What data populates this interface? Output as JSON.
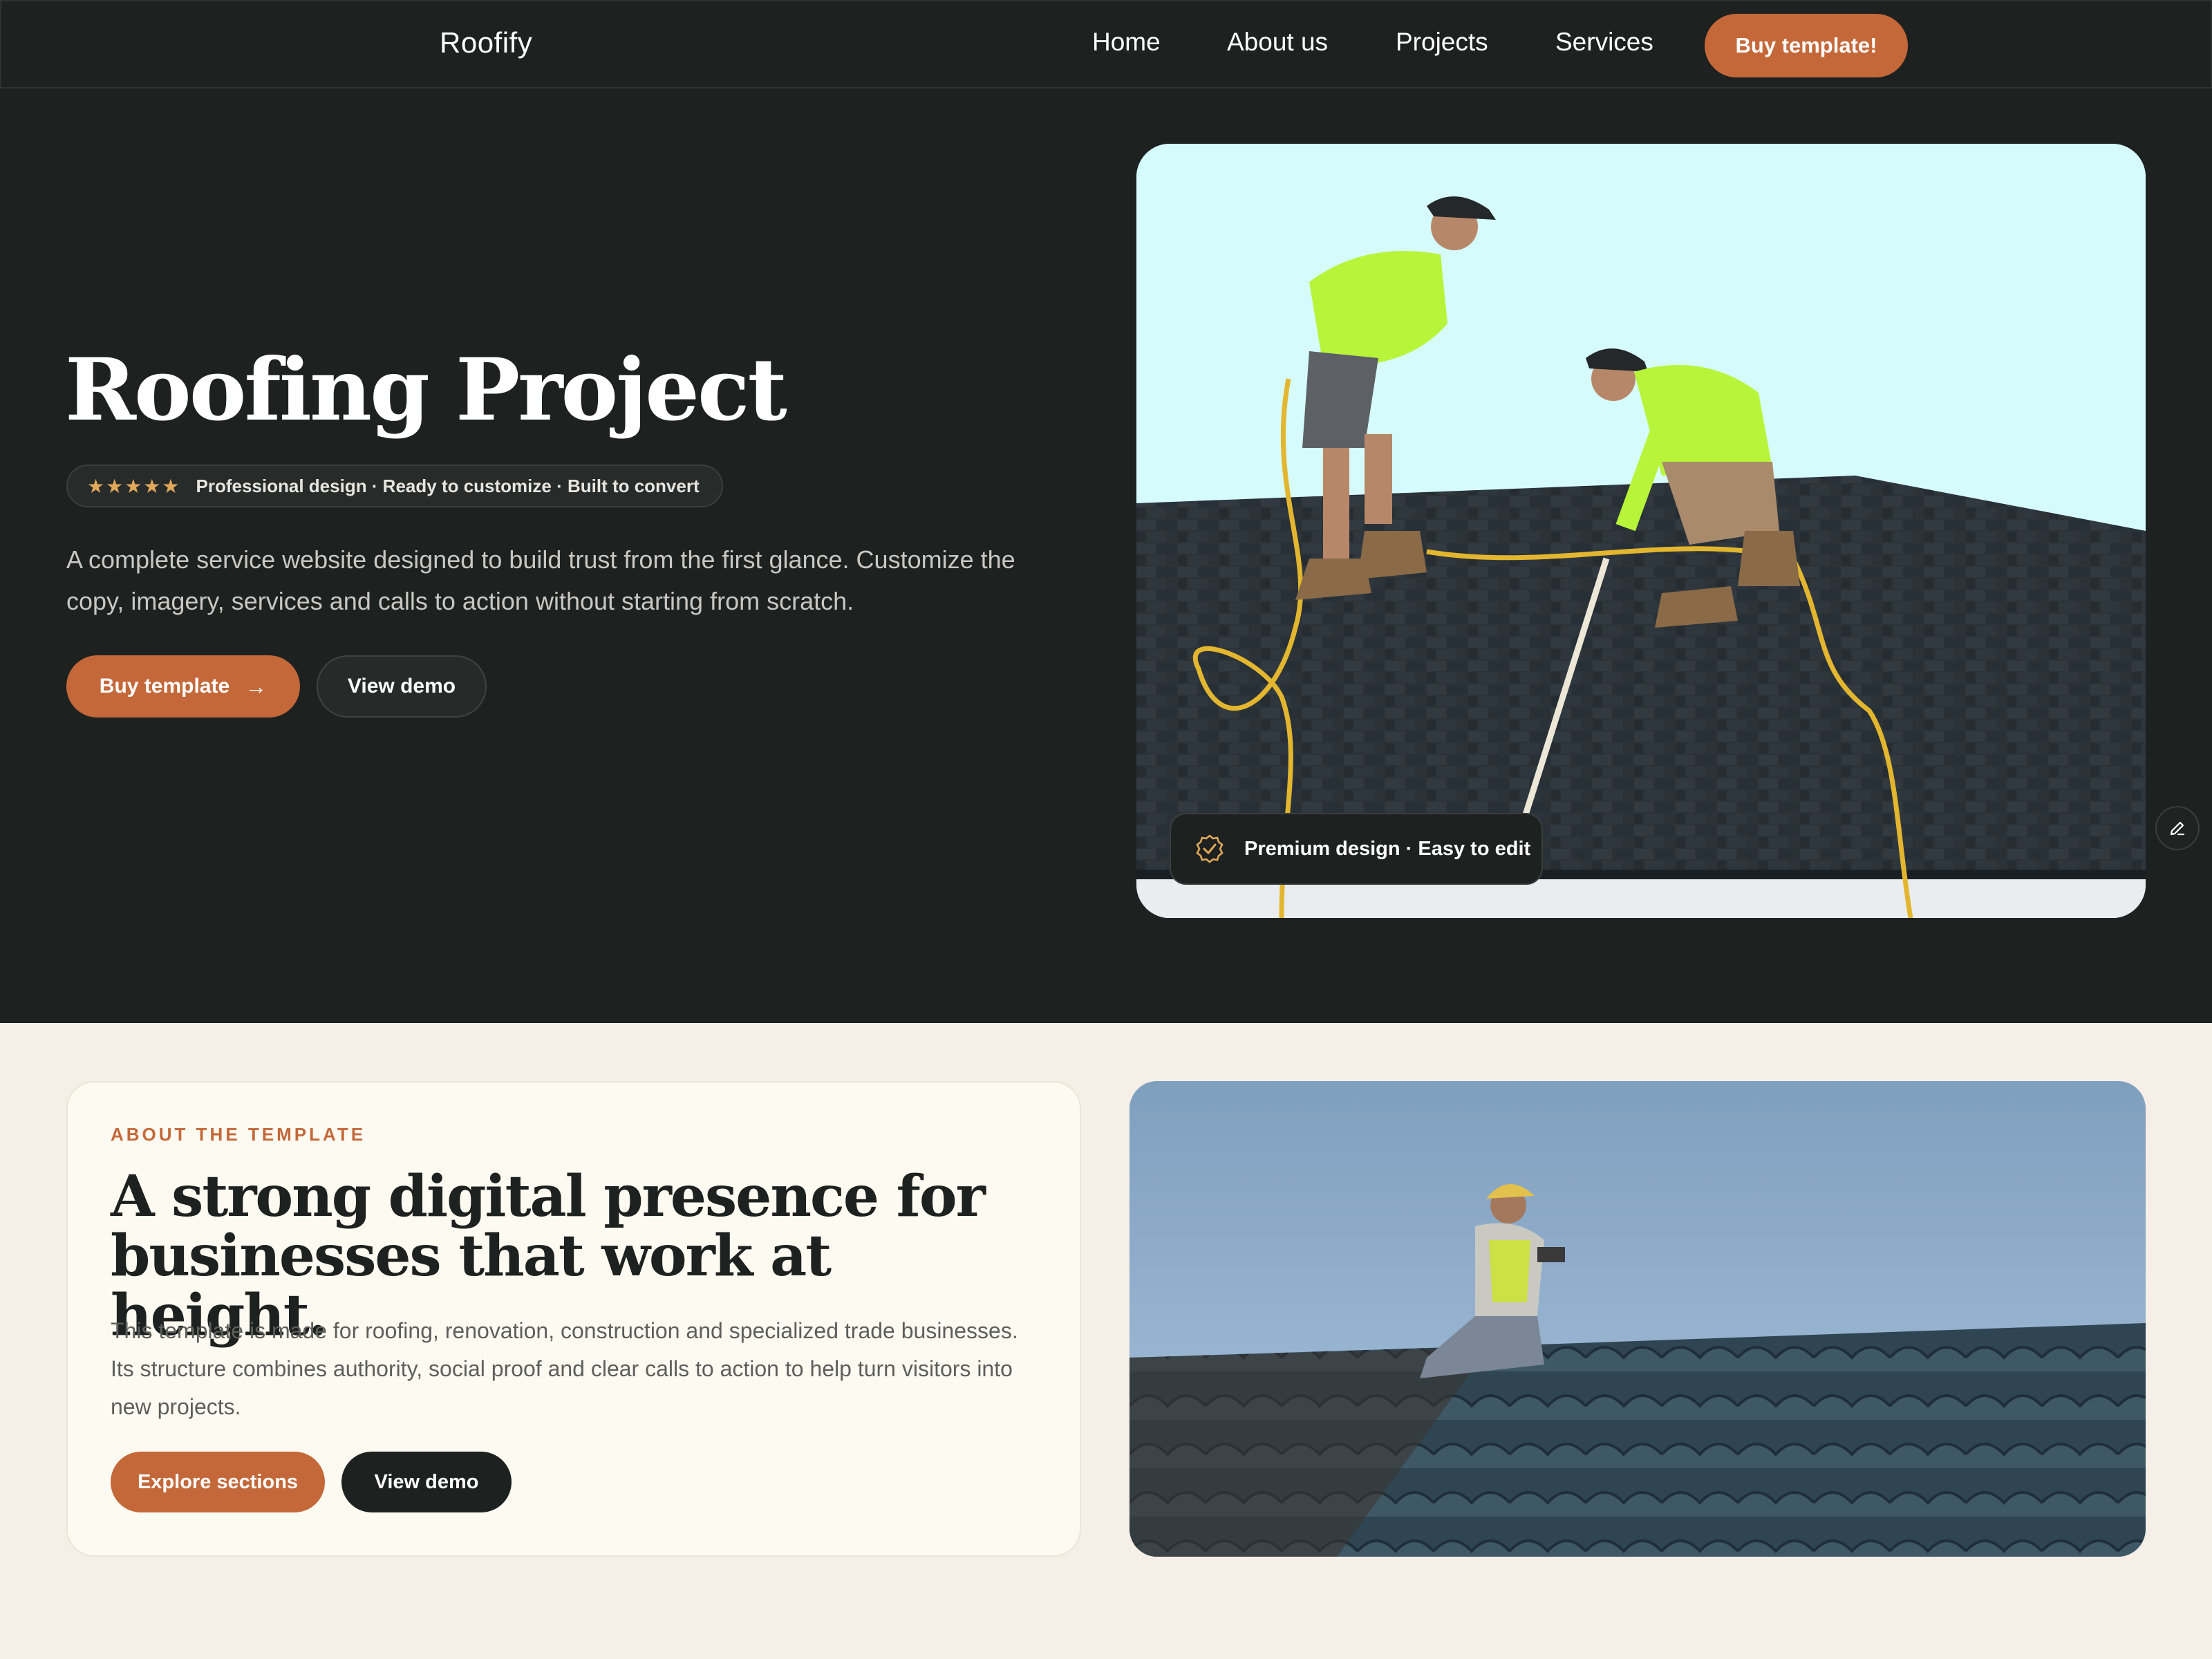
{
  "nav": {
    "logo": "Roofify",
    "links": [
      "Home",
      "About us",
      "Projects",
      "Services"
    ],
    "cta": "Buy template!"
  },
  "hero": {
    "title": "Roofing Project",
    "stars": "★★★★★",
    "rating_text": "Professional design · Ready to customize · Built to convert",
    "description": "A complete service website designed to build trust from the first glance. Customize the copy, imagery, services and calls to action without starting from scratch.",
    "buy_button": "Buy template",
    "demo_button": "View demo",
    "badge_text": "Premium design · Easy to edit"
  },
  "about": {
    "eyebrow": "ABOUT THE TEMPLATE",
    "title": "A strong digital presence for businesses that work at height.",
    "description": "This template is made for roofing, renovation, construction and specialized trade businesses. Its structure combines authority, social proof and clear calls to action to help turn visitors into new projects.",
    "explore_button": "Explore sections",
    "demo_button": "View demo"
  },
  "colors": {
    "accent": "#c4683a",
    "dark": "#1d2120",
    "cream": "#f5efe8"
  }
}
